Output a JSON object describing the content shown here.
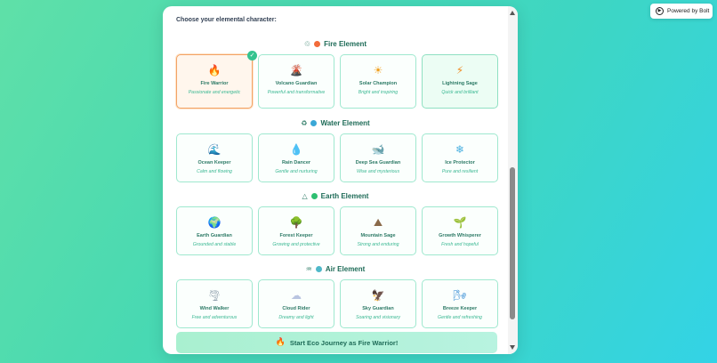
{
  "prompt": "Choose your elemental character:",
  "powered_by": "Powered by Bolt",
  "icons": {
    "bolt": "play-circle-icon",
    "check": "check-icon",
    "scroll_up": "arrow-up-icon",
    "scroll_down": "arrow-down-icon"
  },
  "colors": {
    "fire_dot": "#f26b3a",
    "water_dot": "#3aa7d6",
    "earth_dot": "#2fbf71",
    "air_dot": "#4fb8c9",
    "accent": "#34c38f",
    "selected_border": "#f2a366"
  },
  "sections": {
    "fire": {
      "title": "Fire Element",
      "glyph": "♲",
      "cards": [
        {
          "emoji": "🔥",
          "name": "Fire Warrior",
          "desc": "Passionate and energetic",
          "selected": true
        },
        {
          "emoji": "🌋",
          "name": "Volcano Guardian",
          "desc": "Powerful and transformative"
        },
        {
          "emoji": "☀",
          "name": "Solar Champion",
          "desc": "Bright and inspiring"
        },
        {
          "emoji": "⚡",
          "name": "Lightning Sage",
          "desc": "Quick and brilliant"
        }
      ]
    },
    "water": {
      "title": "Water Element",
      "glyph": "♻",
      "cards": [
        {
          "emoji": "🌊",
          "name": "Ocean Keeper",
          "desc": "Calm and flowing"
        },
        {
          "emoji": "💧",
          "name": "Rain Dancer",
          "desc": "Gentle and nurturing"
        },
        {
          "emoji": "🐋",
          "name": "Deep Sea Guardian",
          "desc": "Wise and mysterious"
        },
        {
          "emoji": "❄",
          "name": "Ice Protector",
          "desc": "Pure and resilient"
        }
      ]
    },
    "earth": {
      "title": "Earth Element",
      "glyph": "△",
      "cards": [
        {
          "emoji": "🌍",
          "name": "Earth Guardian",
          "desc": "Grounded and stable"
        },
        {
          "emoji": "🌳",
          "name": "Forest Keeper",
          "desc": "Growing and protective"
        },
        {
          "emoji": "⛰",
          "name": "Mountain Sage",
          "desc": "Strong and enduring"
        },
        {
          "emoji": "🌱",
          "name": "Growth Whisperer",
          "desc": "Fresh and hopeful"
        }
      ]
    },
    "air": {
      "title": "Air Element",
      "glyph": "♒",
      "cards": [
        {
          "emoji": "🌪",
          "name": "Wind Walker",
          "desc": "Free and adventurous"
        },
        {
          "emoji": "☁",
          "name": "Cloud Rider",
          "desc": "Dreamy and light"
        },
        {
          "emoji": "🦅",
          "name": "Sky Guardian",
          "desc": "Soaring and visionary"
        },
        {
          "emoji": "🌬",
          "name": "Breeze Keeper",
          "desc": "Gentle and refreshing"
        }
      ]
    }
  },
  "start_button": {
    "emoji": "🔥",
    "label": "Start Eco Journey as Fire Warrior!"
  }
}
